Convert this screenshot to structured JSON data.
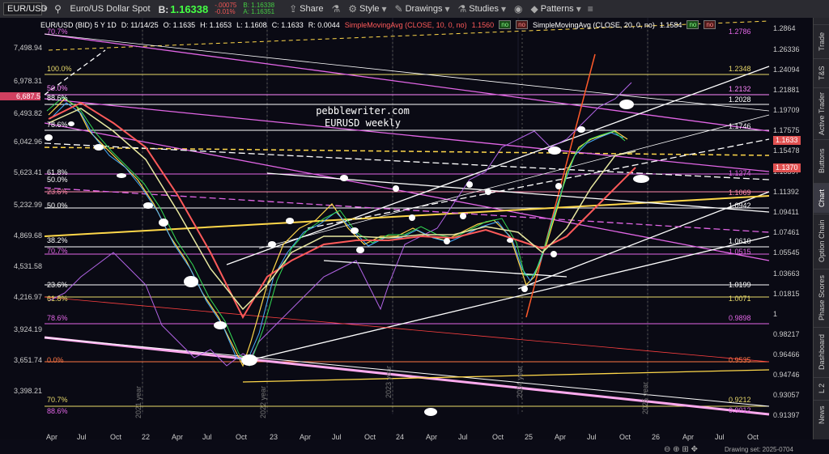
{
  "toolbar": {
    "symbol": "EUR/USD",
    "description": "Euro/US Dollar Spot",
    "bid_label": "B:",
    "bid_value": "1.16338",
    "change": "-.00075",
    "change_pct": "-0.01%",
    "bid_small": "B: 1.16338",
    "ask_small": "A: 1.16351",
    "share": "Share",
    "style": "Style",
    "drawings": "Drawings",
    "studies": "Studies",
    "patterns": "Patterns"
  },
  "infostrip": {
    "pair": "EUR/USD (BID) 5 Y 1D",
    "date": "D: 11/14/25",
    "open": "O: 1.1635",
    "high": "H: 1.1653",
    "low": "L: 1.1608",
    "close": "C: 1.1633",
    "range": "R: 0.0044",
    "sma10": "SimpleMovingAvg (CLOSE, 10, 0, no)",
    "sma10_val": "1.1560",
    "sma20": "SimpleMovingAvg (CLOSE, 20, 0, no)",
    "sma20_val": "1.1584",
    "no1": "no",
    "no2": "no",
    "no3": "no",
    "no4": "no"
  },
  "annotation": {
    "line1": "pebblewriter.com",
    "line2": "EURUSD weekly"
  },
  "left_axis": [
    "7,498.94",
    "6,978.31",
    "6,687.5",
    "6,493.82",
    "6,042.96",
    "5,623.41",
    "5,232.99",
    "4,869.68",
    "4,531.58",
    "4,216.97",
    "3,924.19",
    "3,651.74",
    "3,398.21"
  ],
  "right_axis": [
    "1.2864",
    "1.26336",
    "1.24094",
    "1.21881",
    "1.19709",
    "1.17575",
    "1.15478",
    "1.13397",
    "1.11392",
    "1.09411",
    "1.07461",
    "1.05545",
    "1.03663",
    "1.01815",
    "1",
    "0.98217",
    "0.96466",
    "0.94746",
    "0.93057",
    "0.91397"
  ],
  "right_levels": [
    "1.2786",
    "1.2348",
    "1.2132",
    "1.2028",
    "1.1746",
    "1.1274",
    "1.1069",
    "1.0942",
    "1.0610",
    "1.0515",
    "1.0199",
    "1.0071",
    "0.9898",
    "0.9535",
    "0.9212",
    "0.9012"
  ],
  "price_tags": {
    "current": "1.1633",
    "low": "1.1370"
  },
  "fib_labels": [
    "100.0%",
    "50.0%",
    "88.6%",
    "78.6%",
    "61.8%",
    "50.0%",
    "23.6%",
    "50.0%",
    "38.2%",
    "70.7%",
    "23.6%",
    "61.8%",
    "78.6%",
    "0.0%",
    "70.7%",
    "88.6%",
    "70.7%"
  ],
  "x_axis": [
    "Apr",
    "Jul",
    "Oct",
    "22",
    "Apr",
    "Jul",
    "Oct",
    "23",
    "Apr",
    "Jul",
    "Oct",
    "24",
    "Apr",
    "Jul",
    "Oct",
    "25",
    "Apr",
    "Jul",
    "Oct",
    "26",
    "Apr",
    "Jul",
    "Oct"
  ],
  "year_marks": [
    "2021 year",
    "2022 year",
    "2023 year",
    "2024 year",
    "2025 year"
  ],
  "rail_tabs": [
    "Trade",
    "T&S",
    "Active Trader",
    "Buttons",
    "Chart",
    "Option Chain",
    "Phase Scores",
    "Dashboard",
    "L 2",
    "News"
  ],
  "bottom_text": "Drawing set: 2025-0704",
  "colors": {
    "accent": "#ffd84a",
    "magenta": "#e860e0",
    "red": "#ff4040",
    "white": "#ffffff",
    "background": "#0a0a14"
  }
}
